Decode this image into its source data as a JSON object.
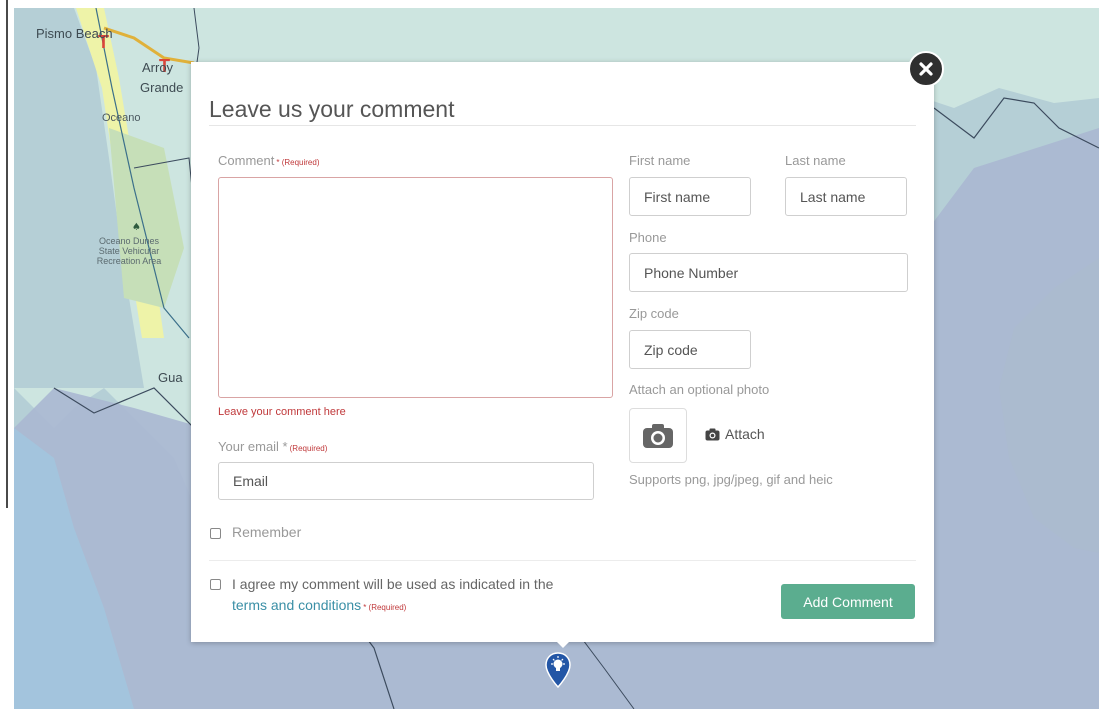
{
  "map": {
    "labels": {
      "pismo_beach": "Pismo Beach",
      "arroyo": "Arroy",
      "grande": "Grande",
      "oceano": "Oceano",
      "dunes_1": "Oceano Dunes",
      "dunes_2": "State Vehicular",
      "dunes_3": "Recreation Area",
      "guadalupe": "Gua"
    },
    "colors": {
      "water": "#b5cfd6",
      "land": "#cde5e0",
      "beach": "#eef3a8",
      "park": "#b3d9b3"
    }
  },
  "modal": {
    "close_icon": "close-x-icon",
    "title": "Leave us your comment",
    "comment": {
      "label": "Comment",
      "required": "* (Required)",
      "hint": "Leave your comment here"
    },
    "email": {
      "label": "Your email *",
      "required": "(Required)",
      "placeholder": "Email"
    },
    "first_name": {
      "label": "First name",
      "placeholder": "First name"
    },
    "last_name": {
      "label": "Last name",
      "placeholder": "Last name"
    },
    "phone": {
      "label": "Phone",
      "placeholder": "Phone Number"
    },
    "zip": {
      "label": "Zip code",
      "placeholder": "Zip code"
    },
    "photo": {
      "label": "Attach an optional photo",
      "camera_icon": "camera-icon",
      "attach_label": "Attach",
      "supports": "Supports png, jpg/jpeg, gif and heic"
    },
    "remember": {
      "label": "Remember",
      "checked": false
    },
    "agree": {
      "text": "I agree my comment will be used as indicated in the",
      "link": "terms and conditions",
      "required": "* (Required)",
      "checked": false
    },
    "submit_label": "Add Comment",
    "accent": "#5bad8f"
  },
  "marker": {
    "icon": "lightbulb-marker-icon",
    "color": "#2356a6"
  }
}
